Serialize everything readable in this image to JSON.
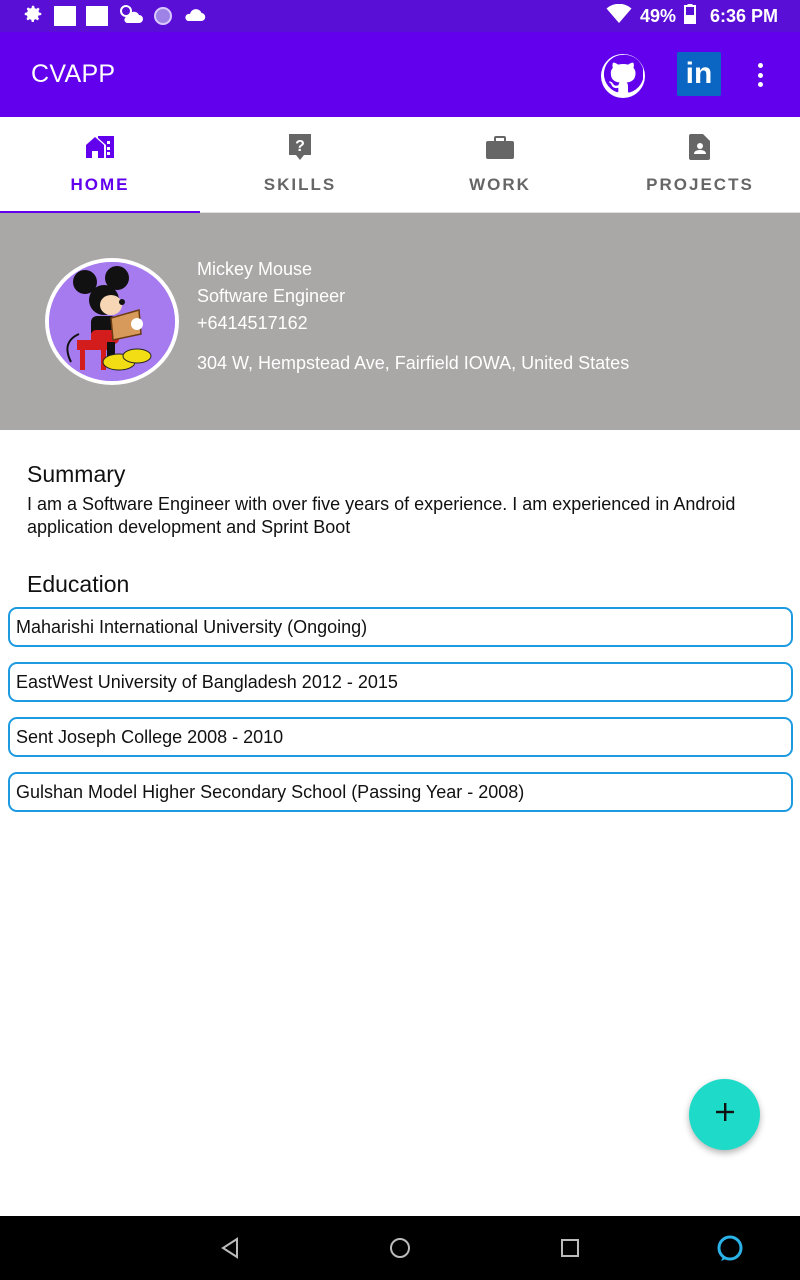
{
  "status_bar": {
    "left_icons": [
      "gear-icon",
      "square-icon",
      "square-icon",
      "cloud-sun-icon",
      "circle-icon",
      "cloud-icon"
    ],
    "battery": "49%",
    "time": "6:36 PM"
  },
  "app_bar": {
    "title": "CVAPP",
    "linkedin_label": "in",
    "color": "#6200ee"
  },
  "tabs": [
    {
      "label": "HOME",
      "icon": "home-icon",
      "active": true
    },
    {
      "label": "SKILLS",
      "icon": "help-icon",
      "active": false
    },
    {
      "label": "WORK",
      "icon": "briefcase-icon",
      "active": false
    },
    {
      "label": "PROJECTS",
      "icon": "contact-file-icon",
      "active": false
    }
  ],
  "profile": {
    "name": "Mickey Mouse",
    "title": "Software Engineer",
    "phone": "+6414517162",
    "address": "304 W, Hempstead Ave, Fairfield IOWA, United States",
    "background": "#aaa7a7"
  },
  "summary": {
    "heading": "Summary",
    "text": "I am a Software Engineer with over five years of experience. I am experienced in Android application development and Sprint Boot"
  },
  "education": {
    "heading": "Education",
    "items": [
      "Maharishi International University (Ongoing)",
      "EastWest University of Bangladesh 2012 - 2015",
      "Sent Joseph College 2008 - 2010",
      "Gulshan Model Higher Secondary School (Passing Year - 2008)"
    ],
    "border_color": "#1e9be0"
  },
  "fab": {
    "icon": "plus-icon",
    "color": "#1ddbc8"
  },
  "nav_bar": {
    "icons": [
      "back-icon",
      "home-circle-icon",
      "recents-icon",
      "assistant-icon"
    ]
  }
}
